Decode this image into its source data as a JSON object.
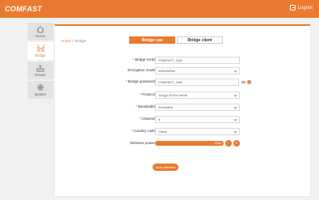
{
  "header": {
    "brand": "COMFAST",
    "logout": "Logout"
  },
  "sidebar": {
    "items": [
      {
        "label": "Home",
        "icon": "home-icon"
      },
      {
        "label": "Bridge",
        "icon": "bridge-icon",
        "active": true
      },
      {
        "label": "Router",
        "icon": "router-icon"
      },
      {
        "label": "system",
        "icon": "gear-icon"
      }
    ]
  },
  "breadcrumb": {
    "home": "Home",
    "separator": ">",
    "current": "Bridge"
  },
  "tabs": [
    {
      "label": "Bridge cpe",
      "active": true
    },
    {
      "label": "Bridge client",
      "active": false
    }
  ],
  "form": {
    "ssid": {
      "label": "Bridge SSID",
      "value": "COMFAST_1AB"
    },
    "encryption": {
      "label": "Encryption mode",
      "value": "WPA/WPA2"
    },
    "password": {
      "label": "Bridge password",
      "value": "COMFAST_1AB"
    },
    "protocol": {
      "label": "Protocol",
      "value": "11ng(2.4GHz) Mode"
    },
    "bandwidth": {
      "label": "Bandwidth",
      "value": "20/40MHz"
    },
    "channel": {
      "label": "Channel",
      "value": "6"
    },
    "country": {
      "label": "Country code",
      "value": "China"
    },
    "power": {
      "label": "Wireless power",
      "value": "20Db",
      "minus": "-",
      "plus": "+"
    }
  },
  "save_label": "Save effective",
  "colors": {
    "accent": "#ea7a30",
    "background": "#f1f1f1",
    "panel": "#ffffff"
  }
}
